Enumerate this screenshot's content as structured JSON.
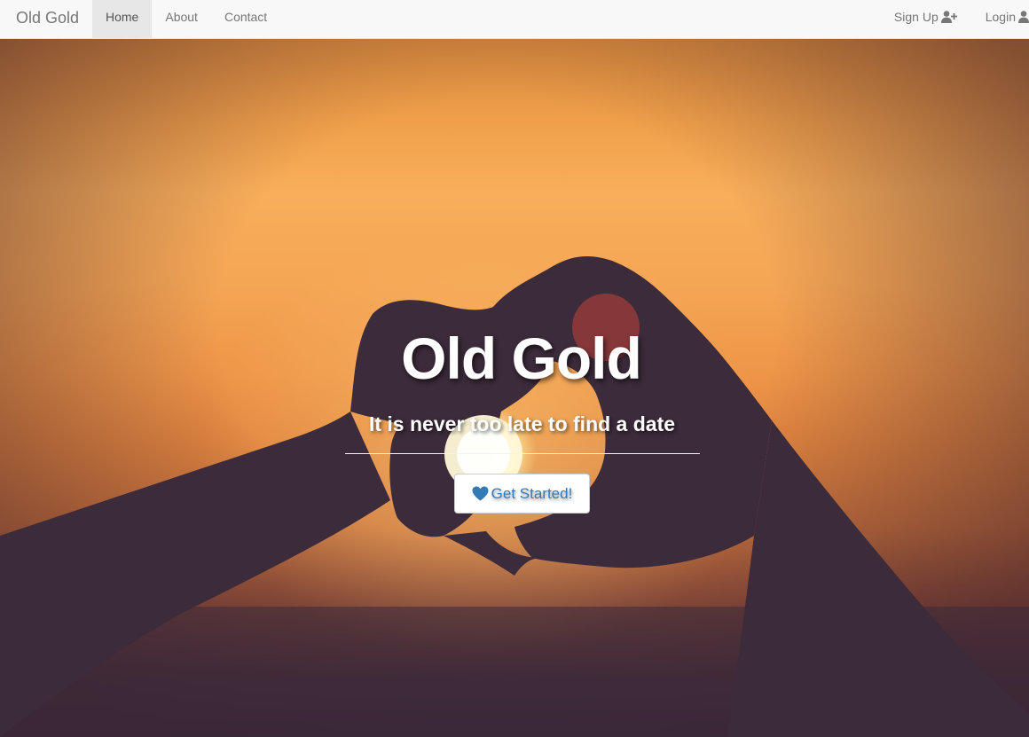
{
  "navbar": {
    "brand": "Old Gold",
    "links": [
      {
        "label": "Home",
        "active": true
      },
      {
        "label": "About",
        "active": false
      },
      {
        "label": "Contact",
        "active": false
      }
    ],
    "right_links": [
      {
        "label": "Sign Up",
        "icon": "user-plus-icon"
      },
      {
        "label": "Login",
        "icon": "user-icon"
      }
    ]
  },
  "hero": {
    "title": "Old Gold",
    "subtitle_prefix": "It is never too late to find a ",
    "subtitle_emphasis": "date",
    "cta_label": "Get Started!",
    "cta_icon": "heart-icon"
  },
  "colors": {
    "navbar_bg": "#f8f8f8",
    "active_tab_bg": "#e7e7e7",
    "nav_text": "#777777",
    "cta_text": "#337ab7",
    "hero_text": "#ffffff"
  }
}
